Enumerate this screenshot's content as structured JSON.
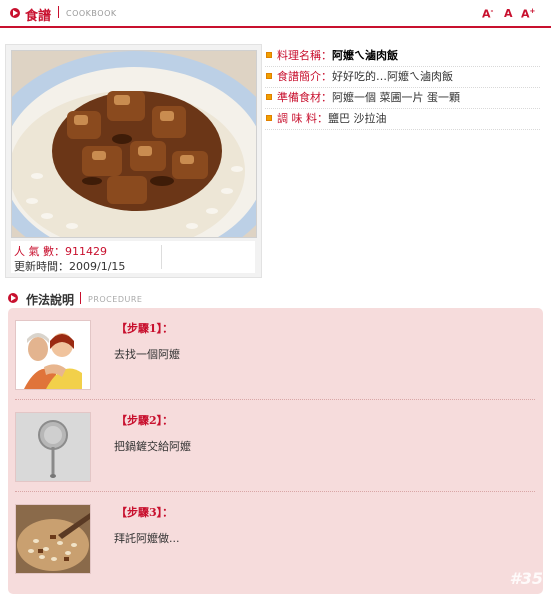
{
  "header": {
    "title": "食譜",
    "subtitle": "COOKBOOK",
    "font_smaller": "A",
    "font_smaller_mark": "-",
    "font_normal": "A",
    "font_larger": "A",
    "font_larger_mark": "+"
  },
  "recipe": {
    "popularity_label": "人 氣 數：",
    "popularity": "911429",
    "updated_label": "更新時間：",
    "updated": "2009/1/15",
    "fields": [
      {
        "label": "料理名稱：",
        "value": "阿嬤ㄟ滷肉飯"
      },
      {
        "label": "食譜簡介：",
        "value": "好好吃的…阿嬤ㄟ滷肉飯"
      },
      {
        "label": "準備食材：",
        "value": "阿嬤一個 菜圃一片 蛋一顆"
      },
      {
        "label": "調 味 料：",
        "value": "鹽巴 沙拉油"
      }
    ]
  },
  "procedure": {
    "title": "作法說明",
    "subtitle": "PROCEDURE",
    "steps": [
      {
        "label": "【步驟1】：",
        "text": "去找一個阿嬤"
      },
      {
        "label": "【步驟2】：",
        "text": "把鍋鏟交給阿嬤"
      },
      {
        "label": "【步驟3】：",
        "text": "拜託阿嬤做..."
      }
    ]
  },
  "watermark": "#35",
  "colors": {
    "accent": "#c8102e",
    "panel": "#f6dcdc",
    "bullet": "#f0a000"
  }
}
